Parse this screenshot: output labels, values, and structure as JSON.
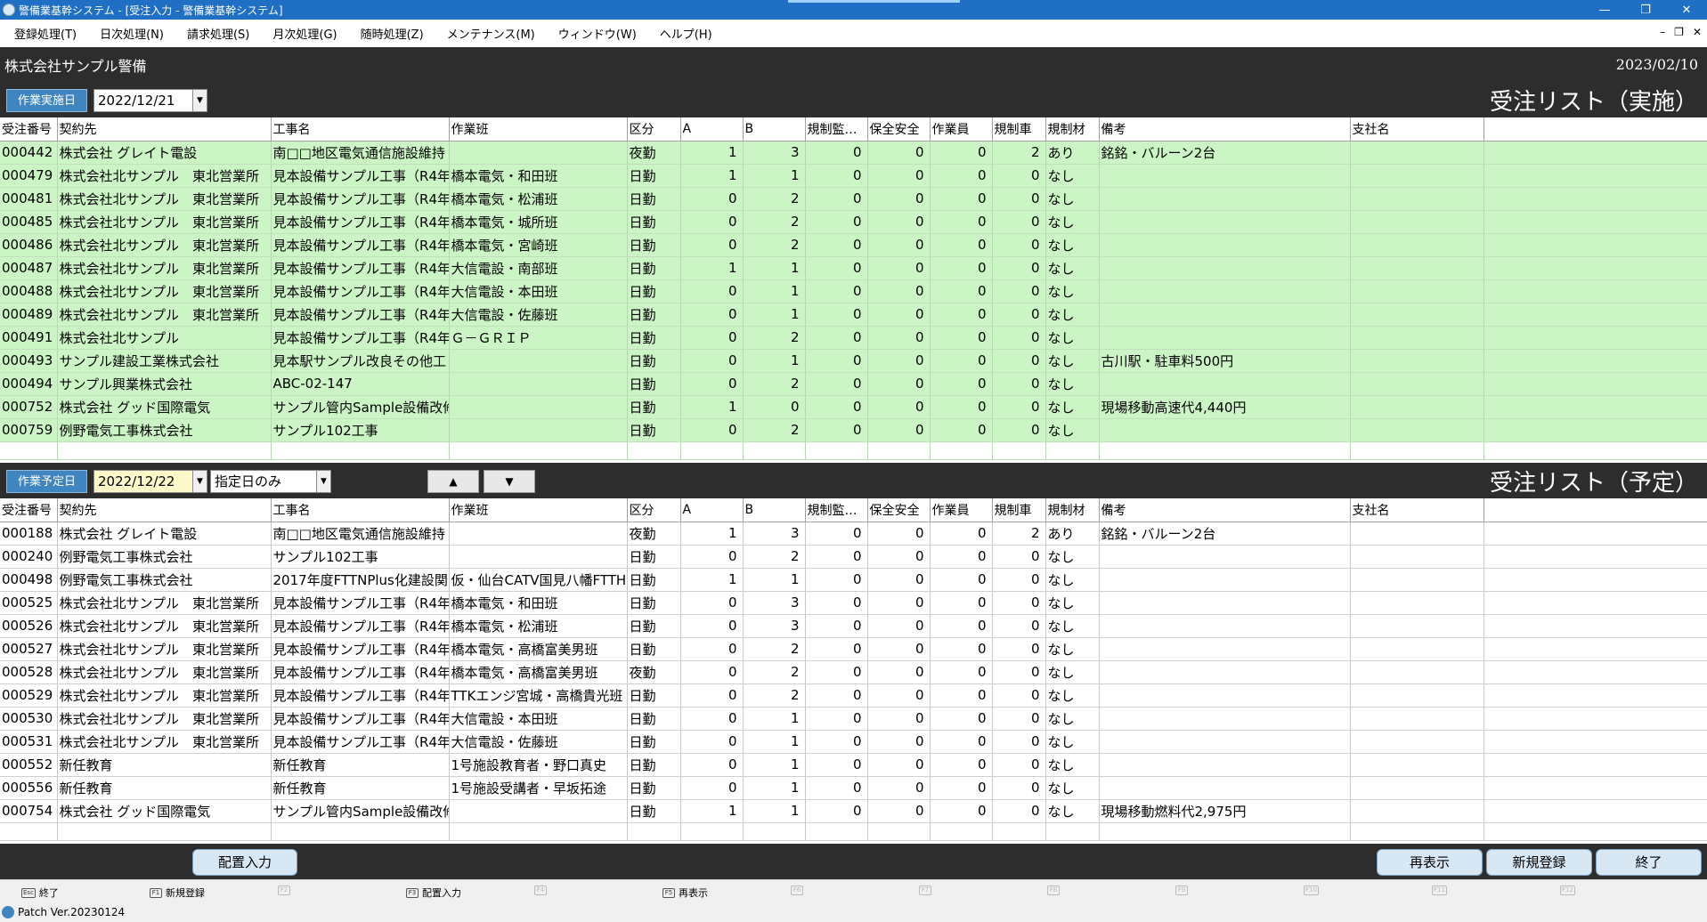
{
  "window": {
    "title": "警備業基幹システム - [受注入力 - 警備業基幹システム]",
    "minimize": "—",
    "restore": "❐",
    "close": "✕"
  },
  "menu": [
    "登録処理(T)",
    "日次処理(N)",
    "請求処理(S)",
    "月次処理(G)",
    "随時処理(Z)",
    "メンテナンス(M)",
    "ウィンドウ(W)",
    "ヘルプ(H)"
  ],
  "mdi": {
    "minimize": "–",
    "restore": "❐",
    "close": "✕"
  },
  "company": {
    "name": "株式会社サンプル警備",
    "date": "2023/02/10"
  },
  "columns": [
    "受注番号",
    "契約先",
    "工事名",
    "作業班",
    "区分",
    "A",
    "B",
    "規制監…",
    "保全安全",
    "作業員",
    "規制車",
    "規制材",
    "備考",
    "支社名"
  ],
  "actual": {
    "label": "作業実施日",
    "date": "2022/12/21",
    "title": "受注リスト（実施）",
    "rows": [
      [
        "000442",
        "株式会社 グレイト電設",
        "南□□地区電気通信施設維持",
        "",
        "夜勤",
        "1",
        "3",
        "0",
        "0",
        "0",
        "2",
        "あり",
        "銘銘・バルーン2台",
        ""
      ],
      [
        "000479",
        "株式会社北サンプル　東北営業所",
        "見本設備サンプル工事（R4年",
        "橋本電気・和田班",
        "日勤",
        "1",
        "1",
        "0",
        "0",
        "0",
        "0",
        "なし",
        "",
        ""
      ],
      [
        "000481",
        "株式会社北サンプル　東北営業所",
        "見本設備サンプル工事（R4年",
        "橋本電気・松浦班",
        "日勤",
        "0",
        "2",
        "0",
        "0",
        "0",
        "0",
        "なし",
        "",
        ""
      ],
      [
        "000485",
        "株式会社北サンプル　東北営業所",
        "見本設備サンプル工事（R4年",
        "橋本電気・城所班",
        "日勤",
        "0",
        "2",
        "0",
        "0",
        "0",
        "0",
        "なし",
        "",
        ""
      ],
      [
        "000486",
        "株式会社北サンプル　東北営業所",
        "見本設備サンプル工事（R4年",
        "橋本電気・宮崎班",
        "日勤",
        "0",
        "2",
        "0",
        "0",
        "0",
        "0",
        "なし",
        "",
        ""
      ],
      [
        "000487",
        "株式会社北サンプル　東北営業所",
        "見本設備サンプル工事（R4年",
        "大信電設・南部班",
        "日勤",
        "1",
        "1",
        "0",
        "0",
        "0",
        "0",
        "なし",
        "",
        ""
      ],
      [
        "000488",
        "株式会社北サンプル　東北営業所",
        "見本設備サンプル工事（R4年",
        "大信電設・本田班",
        "日勤",
        "0",
        "1",
        "0",
        "0",
        "0",
        "0",
        "なし",
        "",
        ""
      ],
      [
        "000489",
        "株式会社北サンプル　東北営業所",
        "見本設備サンプル工事（R4年",
        "大信電設・佐藤班",
        "日勤",
        "0",
        "1",
        "0",
        "0",
        "0",
        "0",
        "なし",
        "",
        ""
      ],
      [
        "000491",
        "株式会社北サンプル",
        "見本設備サンプル工事（R4年",
        "Ｇ－ＧＲＩＰ",
        "日勤",
        "0",
        "2",
        "0",
        "0",
        "0",
        "0",
        "なし",
        "",
        ""
      ],
      [
        "000493",
        "サンプル建設工業株式会社",
        "見本駅サンプル改良その他工",
        "",
        "日勤",
        "0",
        "1",
        "0",
        "0",
        "0",
        "0",
        "なし",
        "古川駅・駐車料500円",
        ""
      ],
      [
        "000494",
        "サンプル興業株式会社",
        "ABC-02-147",
        "",
        "日勤",
        "0",
        "2",
        "0",
        "0",
        "0",
        "0",
        "なし",
        "",
        ""
      ],
      [
        "000752",
        "株式会社 グッド国際電気",
        "サンプル管内Sample設備改修",
        "",
        "日勤",
        "1",
        "0",
        "0",
        "0",
        "0",
        "0",
        "なし",
        "現場移動高速代4,440円",
        ""
      ],
      [
        "000759",
        "例野電気工事株式会社",
        "サンプル102工事",
        "",
        "日勤",
        "0",
        "2",
        "0",
        "0",
        "0",
        "0",
        "なし",
        "",
        ""
      ]
    ]
  },
  "planned": {
    "label": "作業予定日",
    "date": "2022/12/22",
    "filter": "指定日のみ",
    "up": "▲",
    "down": "▼",
    "title": "受注リスト（予定）",
    "rows": [
      [
        "000188",
        "株式会社 グレイト電設",
        "南□□地区電気通信施設維持",
        "",
        "夜勤",
        "1",
        "3",
        "0",
        "0",
        "0",
        "2",
        "あり",
        "銘銘・バルーン2台",
        ""
      ],
      [
        "000240",
        "例野電気工事株式会社",
        "サンプル102工事",
        "",
        "日勤",
        "0",
        "2",
        "0",
        "0",
        "0",
        "0",
        "なし",
        "",
        ""
      ],
      [
        "000498",
        "例野電気工事株式会社",
        "2017年度FTTNPlus化建設関",
        "仮・仙台CATV国見八幡FTTH",
        "日勤",
        "1",
        "1",
        "0",
        "0",
        "0",
        "0",
        "なし",
        "",
        ""
      ],
      [
        "000525",
        "株式会社北サンプル　東北営業所",
        "見本設備サンプル工事（R4年",
        "橋本電気・和田班",
        "日勤",
        "0",
        "3",
        "0",
        "0",
        "0",
        "0",
        "なし",
        "",
        ""
      ],
      [
        "000526",
        "株式会社北サンプル　東北営業所",
        "見本設備サンプル工事（R4年",
        "橋本電気・松浦班",
        "日勤",
        "0",
        "3",
        "0",
        "0",
        "0",
        "0",
        "なし",
        "",
        ""
      ],
      [
        "000527",
        "株式会社北サンプル　東北営業所",
        "見本設備サンプル工事（R4年",
        "橋本電気・高橋富美男班",
        "日勤",
        "0",
        "2",
        "0",
        "0",
        "0",
        "0",
        "なし",
        "",
        ""
      ],
      [
        "000528",
        "株式会社北サンプル　東北営業所",
        "見本設備サンプル工事（R4年",
        "橋本電気・高橋富美男班",
        "夜勤",
        "0",
        "2",
        "0",
        "0",
        "0",
        "0",
        "なし",
        "",
        ""
      ],
      [
        "000529",
        "株式会社北サンプル　東北営業所",
        "見本設備サンプル工事（R4年",
        "TTKエンジ宮城・高橋貴光班",
        "日勤",
        "0",
        "2",
        "0",
        "0",
        "0",
        "0",
        "なし",
        "",
        ""
      ],
      [
        "000530",
        "株式会社北サンプル　東北営業所",
        "見本設備サンプル工事（R4年",
        "大信電設・本田班",
        "日勤",
        "0",
        "1",
        "0",
        "0",
        "0",
        "0",
        "なし",
        "",
        ""
      ],
      [
        "000531",
        "株式会社北サンプル　東北営業所",
        "見本設備サンプル工事（R4年",
        "大信電設・佐藤班",
        "日勤",
        "0",
        "1",
        "0",
        "0",
        "0",
        "0",
        "なし",
        "",
        ""
      ],
      [
        "000552",
        "新任教育",
        "新任教育",
        "1号施設教育者・野口真史",
        "日勤",
        "0",
        "1",
        "0",
        "0",
        "0",
        "0",
        "なし",
        "",
        ""
      ],
      [
        "000556",
        "新任教育",
        "新任教育",
        "1号施設受講者・早坂拓途",
        "日勤",
        "0",
        "1",
        "0",
        "0",
        "0",
        "0",
        "なし",
        "",
        ""
      ],
      [
        "000754",
        "株式会社 グッド国際電気",
        "サンプル管内Sample設備改修",
        "",
        "日勤",
        "1",
        "1",
        "0",
        "0",
        "0",
        "0",
        "なし",
        "現場移動燃料代2,975円",
        ""
      ]
    ]
  },
  "buttons": {
    "assign": "配置入力",
    "refresh": "再表示",
    "new": "新規登録",
    "exit": "終了"
  },
  "fkeys": [
    {
      "key": "Esc",
      "label": "終了"
    },
    {
      "key": "F1",
      "label": "新規登録"
    },
    {
      "key": "F2",
      "label": ""
    },
    {
      "key": "F3",
      "label": "配置入力"
    },
    {
      "key": "F4",
      "label": ""
    },
    {
      "key": "F5",
      "label": "再表示"
    },
    {
      "key": "F6",
      "label": ""
    },
    {
      "key": "F7",
      "label": ""
    },
    {
      "key": "F8",
      "label": ""
    },
    {
      "key": "F9",
      "label": ""
    },
    {
      "key": "F10",
      "label": ""
    },
    {
      "key": "F11",
      "label": ""
    },
    {
      "key": "F12",
      "label": ""
    }
  ],
  "status": {
    "patch": "Patch Ver.20230124"
  }
}
